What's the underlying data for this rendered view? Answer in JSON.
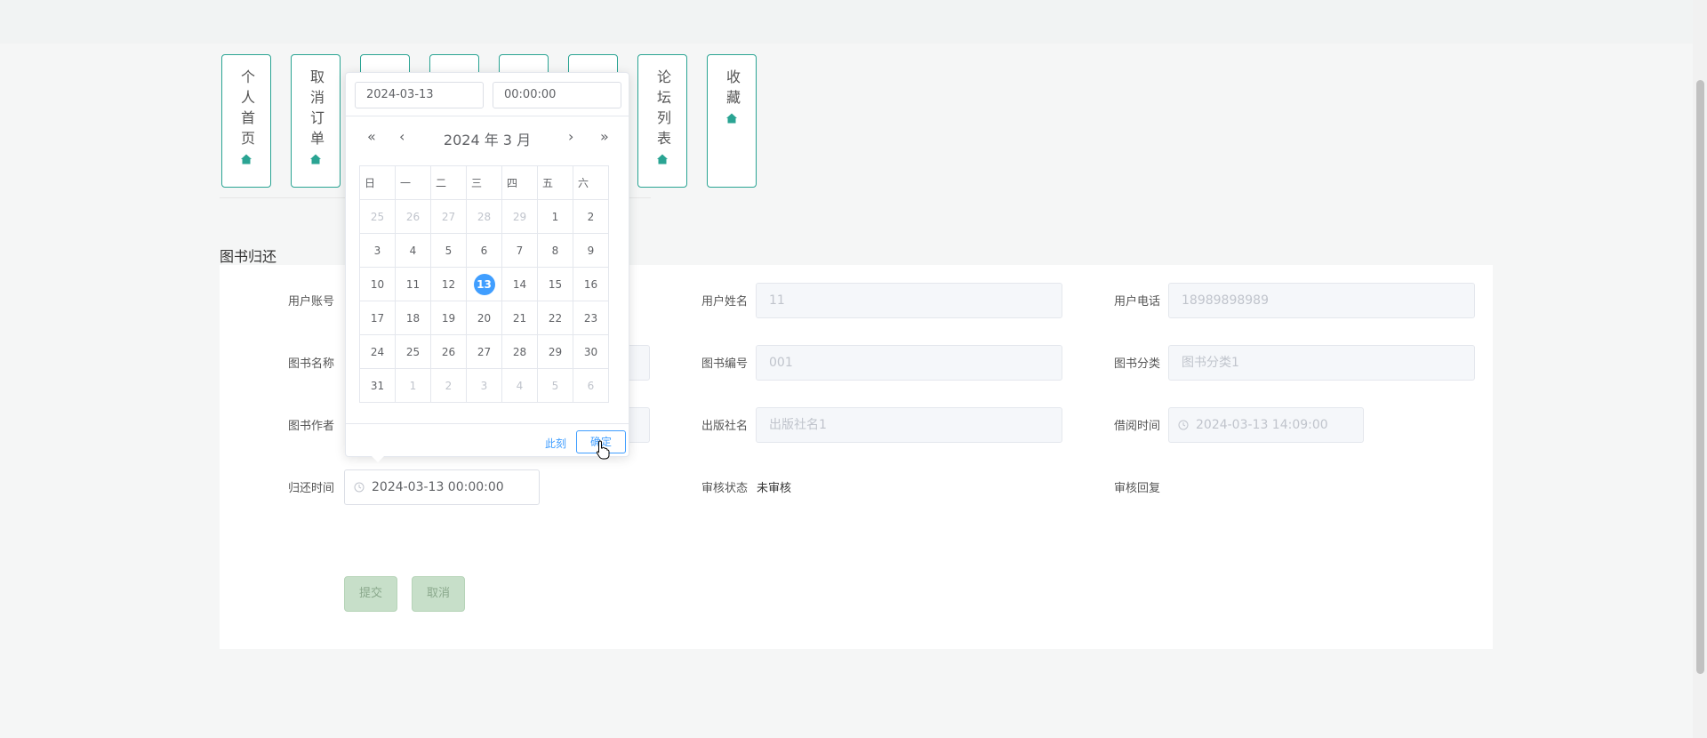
{
  "nav": [
    {
      "label": "个人首页"
    },
    {
      "label": "取消订单"
    },
    {
      "label": ""
    },
    {
      "label": ""
    },
    {
      "label": ""
    },
    {
      "label": ""
    },
    {
      "label": "论坛列表"
    },
    {
      "label": "收藏"
    }
  ],
  "section_title": "图书归还",
  "form": {
    "user_account_label": "用户账号",
    "user_name_label": "用户姓名",
    "user_name_value": "11",
    "user_phone_label": "用户电话",
    "user_phone_value": "18989898989",
    "book_name_label": "图书名称",
    "book_no_label": "图书编号",
    "book_no_value": "001",
    "book_category_label": "图书分类",
    "book_category_value": "图书分类1",
    "book_author_label": "图书作者",
    "publisher_label": "出版社名",
    "publisher_value": "出版社名1",
    "borrow_time_label": "借阅时间",
    "borrow_time_value": "2024-03-13 14:09:00",
    "return_time_label": "归还时间",
    "return_time_value": "2024-03-13 00:00:00",
    "review_status_label": "审核状态",
    "review_status_value": "未审核",
    "review_reply_label": "审核回复"
  },
  "buttons": {
    "submit": "提交",
    "cancel": "取消"
  },
  "picker": {
    "date_value": "2024-03-13",
    "time_value": "00:00:00",
    "title": "2024 年  3 月",
    "weekdays": [
      "日",
      "一",
      "二",
      "三",
      "四",
      "五",
      "六"
    ],
    "weeks": [
      [
        "25",
        "26",
        "27",
        "28",
        "29",
        "1",
        "2"
      ],
      [
        "3",
        "4",
        "5",
        "6",
        "7",
        "8",
        "9"
      ],
      [
        "10",
        "11",
        "12",
        "13",
        "14",
        "15",
        "16"
      ],
      [
        "17",
        "18",
        "19",
        "20",
        "21",
        "22",
        "23"
      ],
      [
        "24",
        "25",
        "26",
        "27",
        "28",
        "29",
        "30"
      ],
      [
        "31",
        "1",
        "2",
        "3",
        "4",
        "5",
        "6"
      ]
    ],
    "selected_day": "13",
    "now_label": "此刻",
    "ok_label": "确定"
  },
  "colors": {
    "accent": "#2aa493",
    "picker_blue": "#409eff",
    "button_green": "#c7dfc9"
  }
}
